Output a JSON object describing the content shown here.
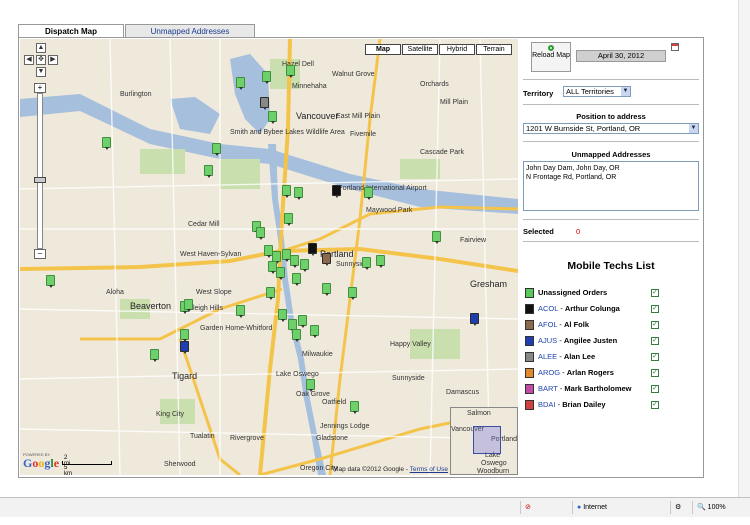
{
  "tabs": [
    {
      "label": "Dispatch Map",
      "active": true
    },
    {
      "label": "Unmapped Addresses",
      "active": false
    }
  ],
  "map": {
    "map_types": [
      "Map",
      "Satellite",
      "Hybrid",
      "Terrain"
    ],
    "active_map_type": "Map",
    "labels": {
      "hazel_dell": "Hazel Dell",
      "walnut_grove": "Walnut Grove",
      "minnehaha": "Minnehaha",
      "orchards": "Orchards",
      "burlington": "Burlington",
      "mill_plain": "Mill Plain",
      "vancouver": "Vancouver",
      "east_mill_plain": "East Mill Plain",
      "fivemile": "Fivemile",
      "sauvie": "Smith and Bybee Lakes Wildlife Area",
      "cascade_park": "Cascade Park",
      "portland_airport": "Portland International Airport",
      "maywood": "Maywood Park",
      "cedar_mill": "Cedar Mill",
      "portland": "Portland",
      "west_haven": "West Haven-Sylvan",
      "sunnyside_area": "Sunnyside",
      "fairview": "Fairview",
      "aloha": "Aloha",
      "beaverton": "Beaverton",
      "west_slope": "West Slope",
      "raleigh": "Raleigh Hills",
      "garden_home": "Garden Home-Whitford",
      "gresham": "Gresham",
      "milwaukie": "Milwaukie",
      "happy_valley": "Happy Valley",
      "tigard": "Tigard",
      "lake_oswego": "Lake Oswego",
      "sunnyside": "Sunnyside",
      "oak_grove": "Oak Grove",
      "damascus": "Damascus",
      "king_city": "King City",
      "oatfield": "Oatfield",
      "jennings": "Jennings Lodge",
      "tualatin": "Tualatin",
      "gladstone": "Gladstone",
      "rivergrove": "Rivergrove",
      "oregon_city": "Oregon City",
      "sherwood": "Sherwood"
    },
    "scale_mi": "2 mi",
    "scale_km": "5 km",
    "attribution": "Map data ©2012 Google - ",
    "terms_label": "Terms of Use",
    "powered_by": "POWERED BY",
    "logo": "Google",
    "overview_labels": {
      "portland": "Portland",
      "lake": "Lake",
      "oswego": "Oswego",
      "salmon": "Salmon",
      "woodburn": "Woodburn",
      "vancouver": "Vancouver"
    }
  },
  "panel": {
    "reload_label": "Reload Map",
    "date": "April 30, 2012",
    "territory_label": "Territory",
    "territory_value": "ALL Territories",
    "position_title": "Position to address",
    "position_value": "1201 W Burnside St, Portland, OR",
    "unmapped_title": "Unmapped Addresses",
    "unmapped_text": "John Day Dam, John Day, OR\nN Frontage Rd, Portland, OR",
    "selected_label": "Selected",
    "selected_count": "0",
    "techs_title": "Mobile Techs List",
    "techs": [
      {
        "code": "",
        "name": "Unassigned Orders",
        "color": "#5ac85a",
        "checked": true
      },
      {
        "code": "ACOL",
        "name": "Arthur Colunga",
        "color": "#111111",
        "checked": true
      },
      {
        "code": "AFOL",
        "name": "Al Folk",
        "color": "#8b6a4c",
        "checked": true
      },
      {
        "code": "AJUS",
        "name": "Angilee Justen",
        "color": "#1f3fb0",
        "checked": true
      },
      {
        "code": "ALEE",
        "name": "Alan Lee",
        "color": "#888888",
        "checked": true
      },
      {
        "code": "AROG",
        "name": "Arlan Rogers",
        "color": "#e08a2a",
        "checked": true
      },
      {
        "code": "BART",
        "name": "Mark Bartholomew",
        "color": "#c44aa8",
        "checked": true
      },
      {
        "code": "BDAI",
        "name": "Brian Dailey",
        "color": "#d04040",
        "checked": true
      }
    ]
  },
  "statusbar": {
    "zone": "Internet",
    "zoom": "100%"
  }
}
